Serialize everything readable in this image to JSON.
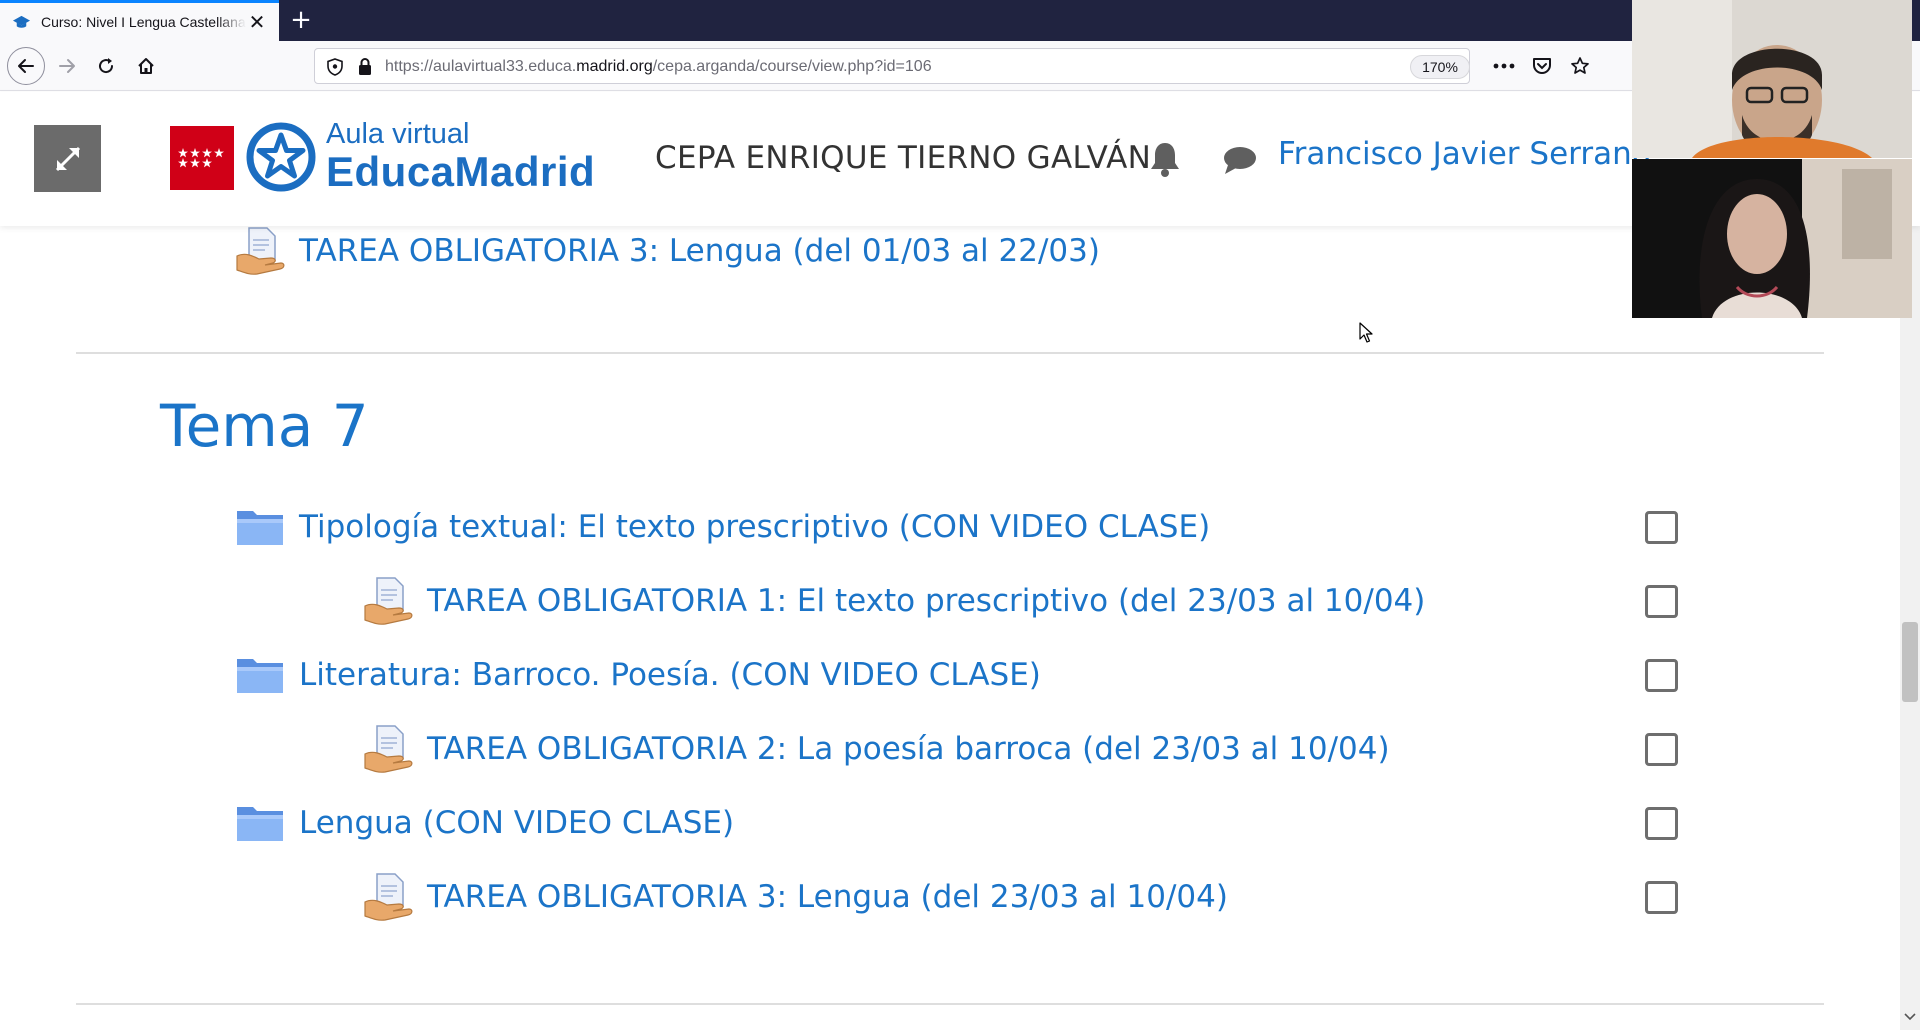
{
  "browser": {
    "tab_title": "Curso: Nivel I Lengua Castellana",
    "tab_close": "✕",
    "new_tab": "+",
    "url_prefix": "https://aulavirtual33.educa.",
    "url_domain": "madrid.org",
    "url_path": "/cepa.arganda/course/view.php?id=106",
    "zoom": "170%"
  },
  "header": {
    "logo_line1": "Aula virtual",
    "logo_line2": "EducaMadrid",
    "site_title": "CEPA ENRIQUE TIERNO GALVÁN",
    "user_name": "Francisco Javier Serrano"
  },
  "content": {
    "top_item": "TAREA OBLIGATORIA 3: Lengua (del 01/03 al 22/03)",
    "section_title": "Tema 7",
    "items": [
      {
        "type": "folder",
        "label": "Tipología textual: El texto prescriptivo (CON VIDEO CLASE)"
      },
      {
        "type": "assign",
        "label": "TAREA OBLIGATORIA 1: El texto prescriptivo (del 23/03 al 10/04)"
      },
      {
        "type": "folder",
        "label": "Literatura: Barroco. Poesía. (CON VIDEO CLASE)"
      },
      {
        "type": "assign",
        "label": "TAREA OBLIGATORIA 2: La poesía barroca (del 23/03 al 10/04)"
      },
      {
        "type": "folder",
        "label": "Lengua (CON VIDEO CLASE)"
      },
      {
        "type": "assign",
        "label": "TAREA OBLIGATORIA 3: Lengua (del 23/03 al 10/04)"
      }
    ]
  },
  "colors": {
    "link": "#1b74c8",
    "brand_blue": "#1b6dc1",
    "madrid_red": "#d00017",
    "tabbar": "#202340"
  },
  "icons": {
    "folder": "folder-icon",
    "assign": "assignment-icon"
  }
}
